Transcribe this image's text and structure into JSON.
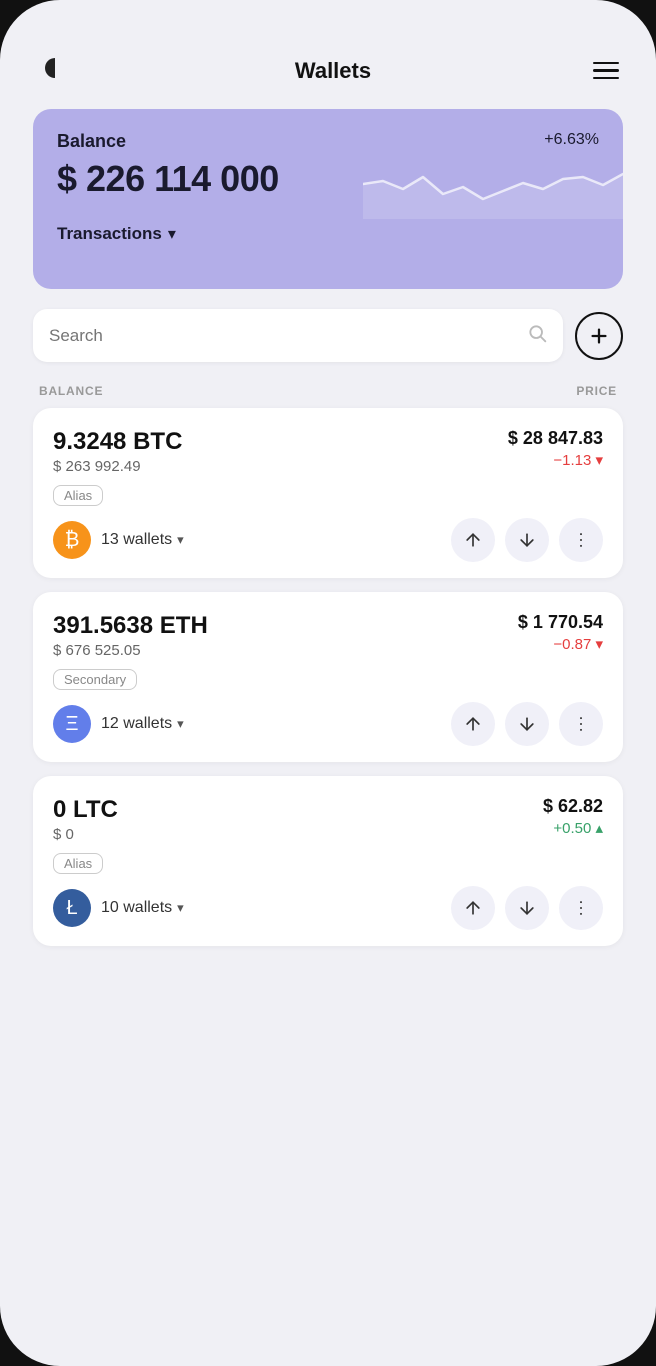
{
  "header": {
    "title": "Wallets",
    "hamburger_label": "menu"
  },
  "balance_card": {
    "label": "Balance",
    "percent": "+6.63%",
    "amount": "$ 226 114 000",
    "transactions_label": "Transactions"
  },
  "search": {
    "placeholder": "Search"
  },
  "table_headers": {
    "balance": "BALANCE",
    "price": "PRICE"
  },
  "assets": [
    {
      "amount": "9.3248 BTC",
      "usd_value": "$ 263 992.49",
      "badge": "Alias",
      "wallet_count": "13 wallets",
      "price": "$ 28 847.83",
      "change": "−1.13 ▾",
      "change_type": "negative",
      "coin_type": "btc",
      "coin_symbol": "₿"
    },
    {
      "amount": "391.5638 ETH",
      "usd_value": "$ 676 525.05",
      "badge": "Secondary",
      "wallet_count": "12 wallets",
      "price": "$ 1 770.54",
      "change": "−0.87 ▾",
      "change_type": "negative",
      "coin_type": "eth",
      "coin_symbol": "Ξ"
    },
    {
      "amount": "0 LTC",
      "usd_value": "$ 0",
      "badge": "Alias",
      "wallet_count": "10 wallets",
      "price": "$ 62.82",
      "change": "+0.50 ▴",
      "change_type": "positive",
      "coin_type": "ltc",
      "coin_symbol": "Ł"
    }
  ]
}
